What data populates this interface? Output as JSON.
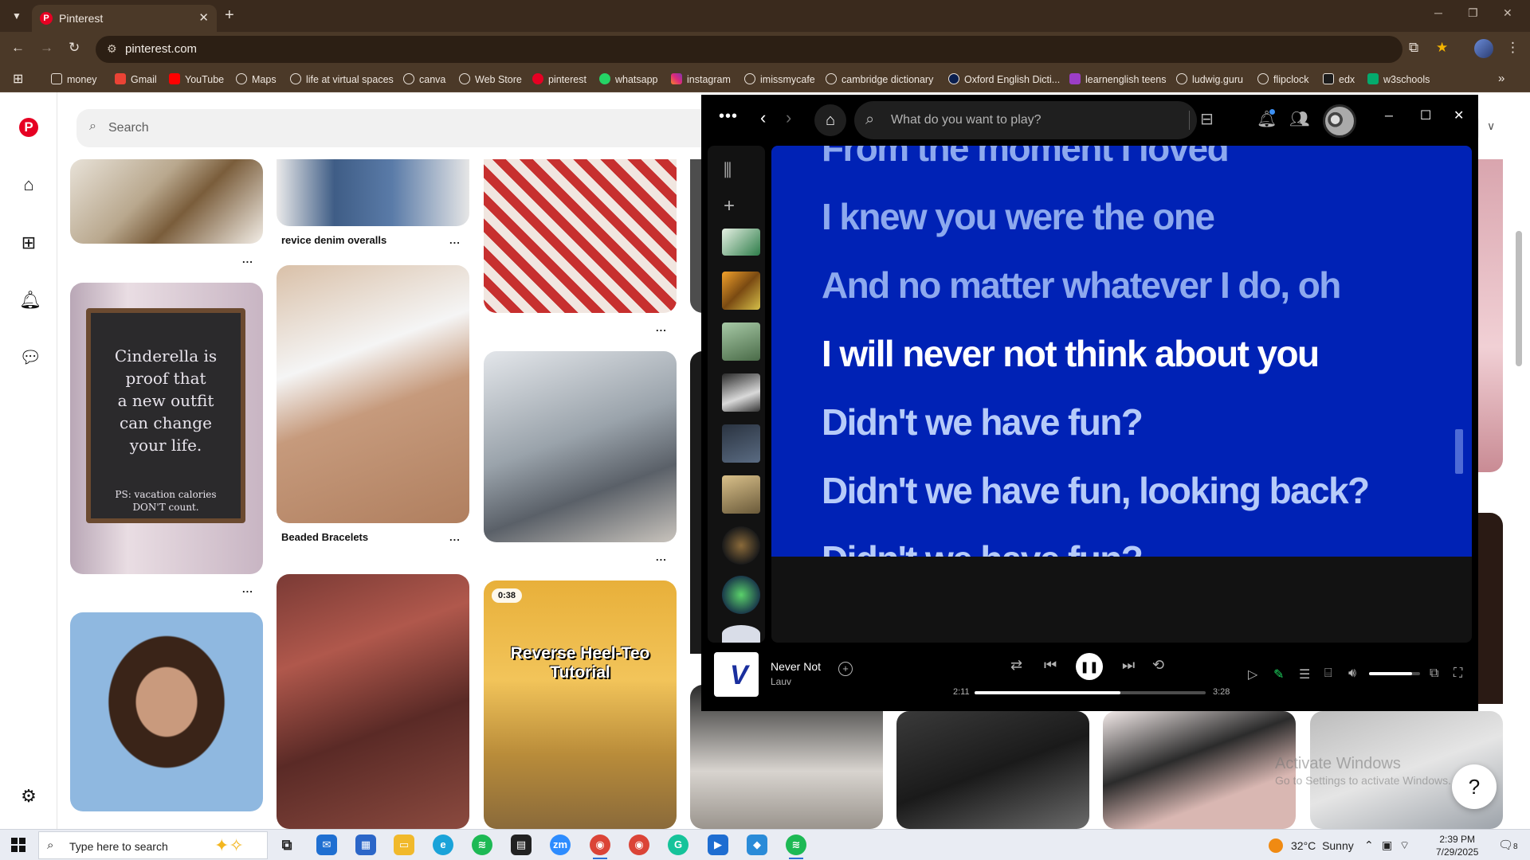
{
  "browser": {
    "tab_title": "Pinterest",
    "url": "pinterest.com",
    "bookmarks": [
      "money",
      "Gmail",
      "YouTube",
      "Maps",
      "life at virtual spaces",
      "canva",
      "Web Store",
      "pinterest",
      "whatsapp",
      "instagram",
      "imissmycafe",
      "cambridge dictionary",
      "Oxford English Dicti...",
      "learnenglish teens",
      "ludwig.guru",
      "flipclock",
      "edx",
      "w3schools"
    ]
  },
  "pinterest": {
    "search_placeholder": "Search",
    "pins": {
      "p2_label": "revice denim overalls",
      "p5_label": "Beaded Bracelets",
      "chalk_line1": "Cinderella is",
      "chalk_line2": "proof that",
      "chalk_line3": "a new outfit",
      "chalk_line4": "can change",
      "chalk_line5": "your life.",
      "chalk_ps1": "PS: vacation calories",
      "chalk_ps2": "DON'T count.",
      "video_badge": "0:38",
      "video_title_1": "Reverse Heel-Teo",
      "video_title_2": "Tutorial",
      "more": "..."
    },
    "watermark_title": "Activate Windows",
    "watermark_sub": "Go to Settings to activate Windows.",
    "help": "?"
  },
  "spotify": {
    "search_placeholder": "What do you want to play?",
    "lyrics": {
      "l0": "From the moment I loved",
      "l1": "I knew you were the one",
      "l2": "And no matter whatever I do, oh",
      "l3": "I will never not think about you",
      "l4": "Didn't we have fun?",
      "l5": "Didn't we have fun, looking back?",
      "l6": "Didn't we have fun?"
    },
    "now_playing": {
      "title": "Never Not",
      "artist": "Lauv",
      "elapsed": "2:11",
      "duration": "3:28",
      "progress": 0.63,
      "volume": 0.85
    }
  },
  "taskbar": {
    "search_placeholder": "Type here to search",
    "temperature": "32°C",
    "condition": "Sunny",
    "time": "2:39 PM",
    "date": "7/29/2025",
    "notif_count": "8"
  }
}
